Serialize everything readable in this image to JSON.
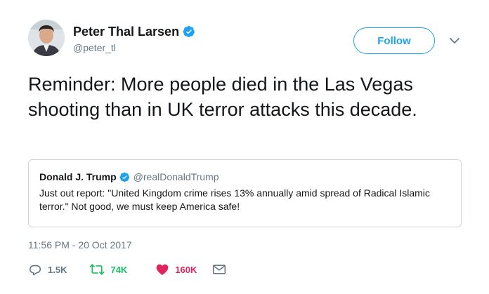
{
  "author": {
    "display_name": "Peter Thal Larsen",
    "handle": "@peter_tl",
    "verified": true
  },
  "follow_label": "Follow",
  "tweet_text": "Reminder: More people died in the Las Vegas shooting than in UK terror attacks this decade.",
  "quoted_tweet": {
    "display_name": "Donald J. Trump",
    "handle": "@realDonaldTrump",
    "verified": true,
    "text": "Just out report: \"United Kingdom crime rises 13% annually amid spread of Radical Islamic terror.\" Not good, we must keep America safe!"
  },
  "timestamp": "11:56 PM - 20 Oct 2017",
  "actions": {
    "replies": "1.5K",
    "retweets": "74K",
    "likes": "160K"
  },
  "icons": {
    "verified": "verified-badge-icon",
    "more": "chevron-down-icon",
    "reply": "reply-icon",
    "retweet": "retweet-icon",
    "like": "heart-icon",
    "dm": "envelope-icon"
  },
  "colors": {
    "brand": "#1da1f2",
    "retweet": "#17bf63",
    "like": "#e0245e",
    "secondary_text": "#657786"
  }
}
